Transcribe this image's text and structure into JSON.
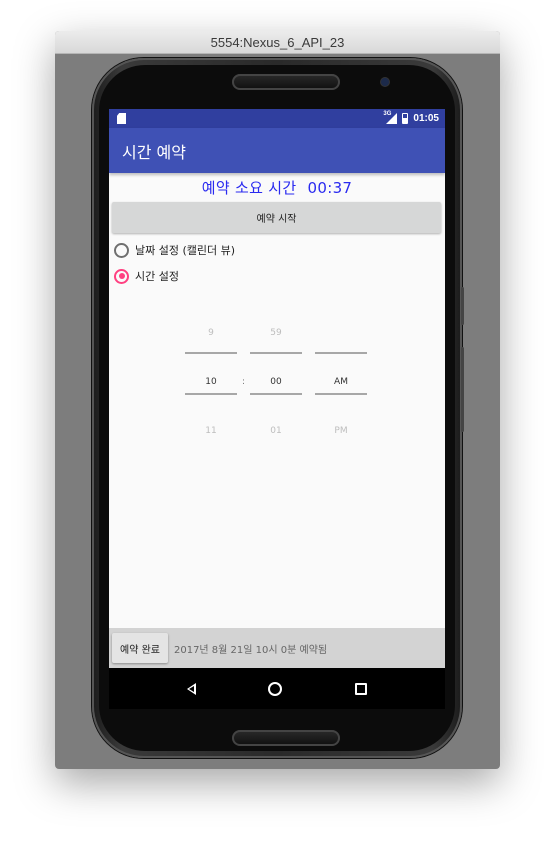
{
  "emulator": {
    "title": "5554:Nexus_6_API_23"
  },
  "status_bar": {
    "time": "01:05",
    "network": "3G",
    "icons": [
      "sd-card-icon",
      "signal-icon",
      "battery-icon"
    ]
  },
  "app_bar": {
    "title": "시간 예약"
  },
  "elapsed": {
    "label": "예약 소요 시간",
    "value": "00:37"
  },
  "start_button": {
    "label": "예약 시작"
  },
  "radios": [
    {
      "label": "날짜 설정 (캘린더 뷰)",
      "checked": false
    },
    {
      "label": "시간 설정",
      "checked": true
    }
  ],
  "time_picker": {
    "separator": ":",
    "hour": {
      "prev": "9",
      "selected": "10",
      "next": "11"
    },
    "minute": {
      "prev": "59",
      "selected": "00",
      "next": "01"
    },
    "ampm": {
      "prev": "",
      "selected": "AM",
      "next": "PM"
    }
  },
  "bottom_bar": {
    "done_label": "예약 완료",
    "result_text": "2017년 8월 21일 10시 0분 예약됨"
  },
  "nav_bar": {
    "icons": [
      "back-icon",
      "home-icon",
      "recents-icon"
    ]
  },
  "colors": {
    "primary": "#3f51b5",
    "primary_dark": "#303f9f",
    "accent": "#ff4081",
    "elapsed_text": "#2a2af0"
  }
}
